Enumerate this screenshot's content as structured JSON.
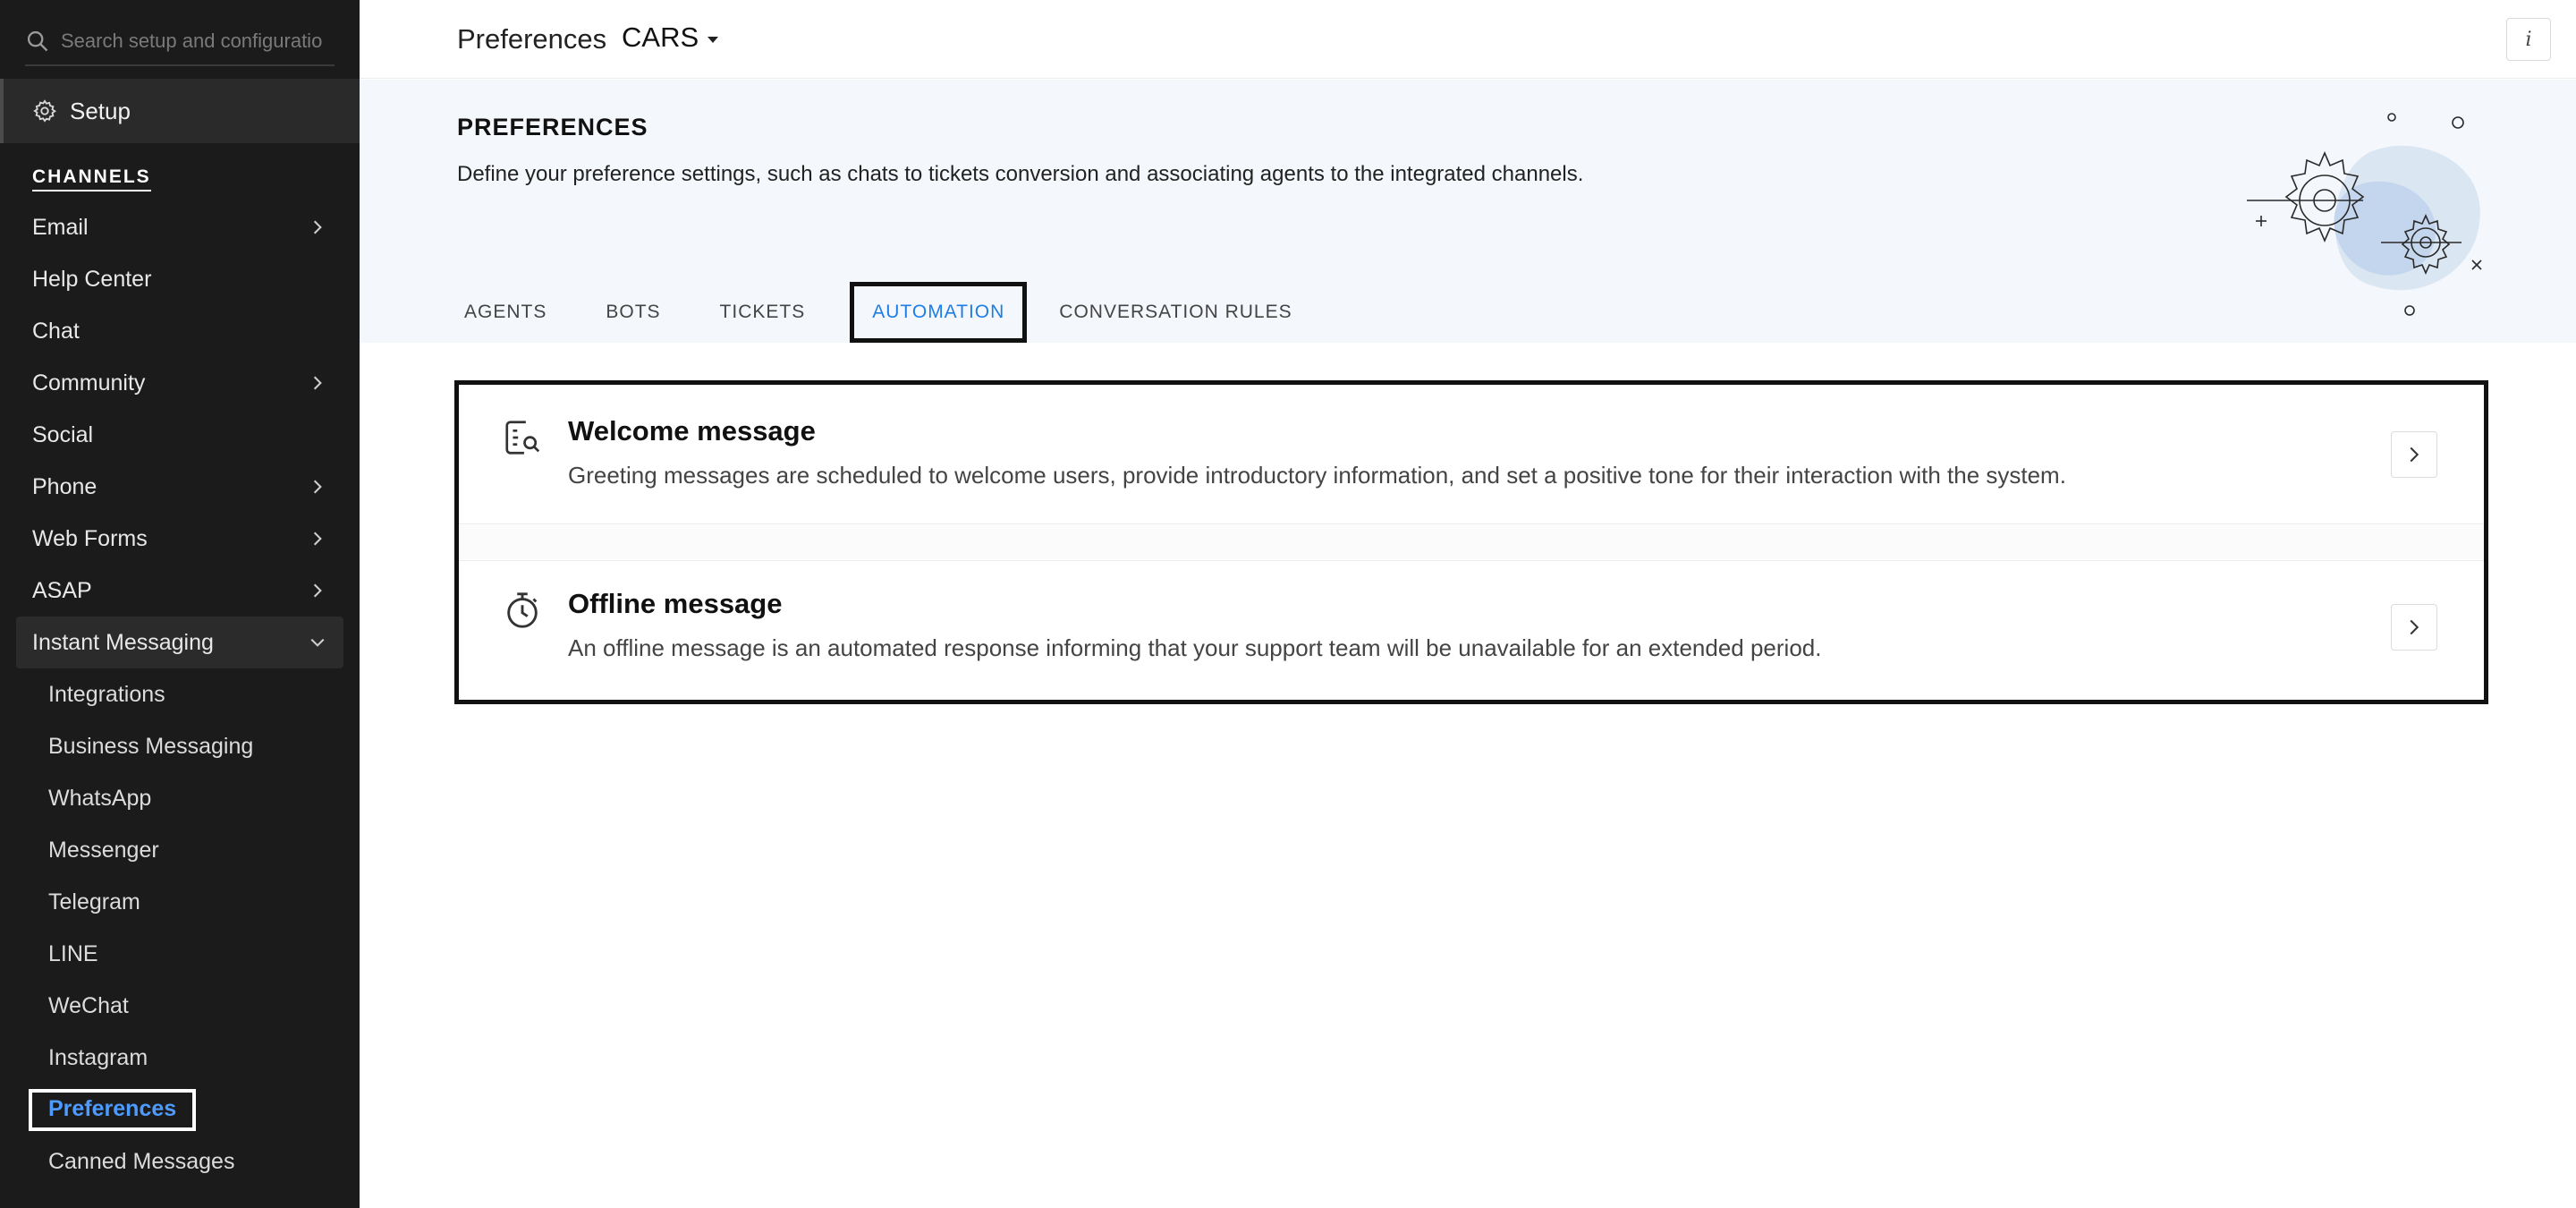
{
  "sidebar": {
    "search_placeholder": "Search setup and configuratio",
    "setup_label": "Setup",
    "section_label": "CHANNELS",
    "items": [
      {
        "label": "Email",
        "has_chevron": true
      },
      {
        "label": "Help Center",
        "has_chevron": false
      },
      {
        "label": "Chat",
        "has_chevron": false
      },
      {
        "label": "Community",
        "has_chevron": true
      },
      {
        "label": "Social",
        "has_chevron": false
      },
      {
        "label": "Phone",
        "has_chevron": true
      },
      {
        "label": "Web Forms",
        "has_chevron": true
      },
      {
        "label": "ASAP",
        "has_chevron": true
      },
      {
        "label": "Instant Messaging",
        "expanded": true
      }
    ],
    "subitems": [
      {
        "label": "Integrations"
      },
      {
        "label": "Business Messaging"
      },
      {
        "label": "WhatsApp"
      },
      {
        "label": "Messenger"
      },
      {
        "label": "Telegram"
      },
      {
        "label": "LINE"
      },
      {
        "label": "WeChat"
      },
      {
        "label": "Instagram"
      },
      {
        "label": "Preferences",
        "active": true
      },
      {
        "label": "Canned Messages"
      }
    ]
  },
  "header": {
    "title": "Preferences",
    "department": "CARS",
    "info_icon": "info-icon"
  },
  "banner": {
    "heading": "PREFERENCES",
    "description": "Define your preference settings, such as chats to tickets conversion and associating agents to the integrated channels."
  },
  "tabs": [
    {
      "label": "AGENTS"
    },
    {
      "label": "BOTS"
    },
    {
      "label": "TICKETS"
    },
    {
      "label": "AUTOMATION",
      "active": true
    },
    {
      "label": "CONVERSATION RULES"
    }
  ],
  "cards": [
    {
      "title": "Welcome message",
      "description": "Greeting messages are scheduled to welcome users, provide introductory information, and set a positive tone for their interaction with the system.",
      "icon": "message-search-icon"
    },
    {
      "title": "Offline message",
      "description": "An offline message is an automated response informing that your support team will be unavailable for an extended period.",
      "icon": "stopwatch-icon"
    }
  ],
  "colors": {
    "sidebar_bg": "#1b1b1b",
    "active_link": "#4d9bff",
    "tab_active": "#1f7ee6",
    "banner_bg": "#f4f7fb"
  }
}
